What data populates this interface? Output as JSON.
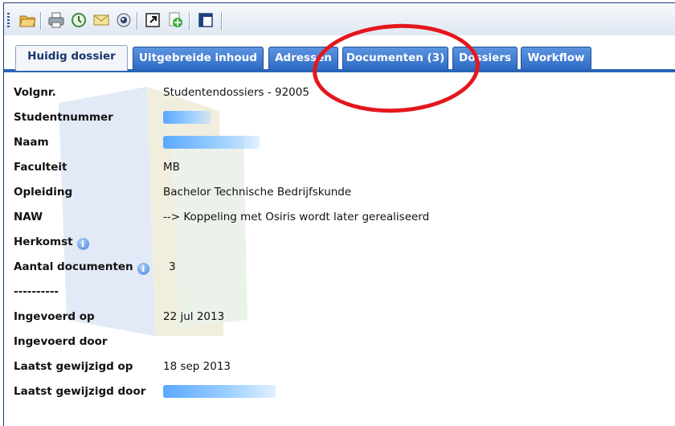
{
  "toolbar": {
    "buttons": [
      "folder-open-icon",
      "print-icon",
      "history-icon",
      "mail-icon",
      "preview-icon",
      "open-external-icon",
      "add-document-icon",
      "layout-icon"
    ]
  },
  "tabs": [
    {
      "label": "Huidig dossier",
      "active": true
    },
    {
      "label": "Uitgebreide inhoud",
      "active": false
    },
    {
      "label": "Adressen",
      "active": false
    },
    {
      "label": "Documenten (3)",
      "active": false
    },
    {
      "label": "Dossiers",
      "active": false
    },
    {
      "label": "Workflow",
      "active": false
    }
  ],
  "fields": [
    {
      "label": "Volgnr.",
      "value": "Studentendossiers - 92005"
    },
    {
      "label": "Studentnummer",
      "value": ""
    },
    {
      "label": "Naam",
      "value": ""
    },
    {
      "label": "Faculteit",
      "value": "MB"
    },
    {
      "label": "Opleiding",
      "value": "Bachelor Technische Bedrijfskunde"
    },
    {
      "label": "NAW",
      "value": "--> Koppeling met Osiris wordt later gerealiseerd"
    },
    {
      "label": "Herkomst",
      "value": ""
    },
    {
      "label": "Aantal documenten",
      "value": "3"
    },
    {
      "label": "----------",
      "value": ""
    },
    {
      "label": "Ingevoerd op",
      "value": "22 jul 2013"
    },
    {
      "label": "Ingevoerd door",
      "value": ""
    },
    {
      "label": "Laatst gewijzigd op",
      "value": "18 sep 2013"
    },
    {
      "label": "Laatst gewijzigd door",
      "value": ""
    }
  ],
  "colors": {
    "tab_blue": "#2f6cc6",
    "annotation_red": "#e4171d",
    "redaction_blue": "#5aa8ff"
  }
}
